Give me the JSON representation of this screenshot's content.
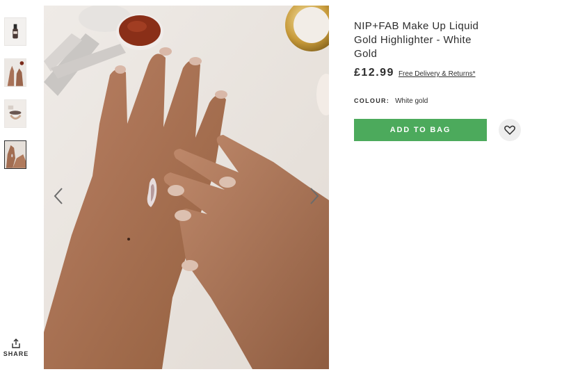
{
  "product": {
    "title": "NIP+FAB Make Up Liquid Gold Highlighter - White Gold",
    "price": "£12.99",
    "delivery_link": "Free Delivery & Returns*",
    "colour_label": "COLOUR:",
    "colour_value": "White gold",
    "add_to_bag_label": "ADD TO BAG"
  },
  "gallery": {
    "thumbnails": [
      {
        "name": "product-bottle",
        "active": false
      },
      {
        "name": "hands-application",
        "active": false
      },
      {
        "name": "product-closeup",
        "active": false
      },
      {
        "name": "hand-swatch",
        "active": true
      }
    ]
  },
  "share": {
    "label": "SHARE"
  },
  "icons": {
    "save": "heart-icon",
    "share": "share-icon",
    "prev": "chevron-left-icon",
    "next": "chevron-right-icon"
  },
  "colors": {
    "accent_green": "#4caa5c",
    "text": "#2d2d2d",
    "wishlist_bg": "#eeeeee"
  }
}
